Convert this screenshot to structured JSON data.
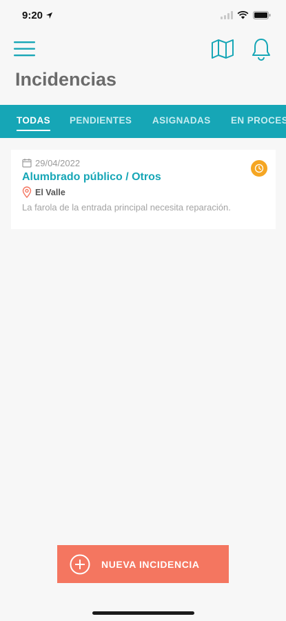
{
  "status_bar": {
    "time": "9:20"
  },
  "header": {
    "title": "Incidencias"
  },
  "tabs": [
    {
      "label": "TODAS",
      "active": true
    },
    {
      "label": "PENDIENTES",
      "active": false
    },
    {
      "label": "ASIGNADAS",
      "active": false
    },
    {
      "label": "EN PROCESO",
      "active": false
    }
  ],
  "incidents": [
    {
      "date": "29/04/2022",
      "title": "Alumbrado público / Otros",
      "location": "El Valle",
      "description": "La farola de la entrada principal necesita reparación.",
      "status_icon": "clock-icon"
    }
  ],
  "actions": {
    "new_incident_label": "NUEVA INCIDENCIA"
  },
  "colors": {
    "accent": "#16a6b6",
    "button": "#f47660",
    "status_pending": "#f5a623"
  }
}
